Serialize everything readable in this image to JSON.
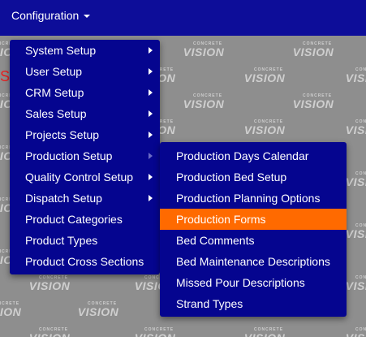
{
  "nav": {
    "menu_label": "Configuration",
    "left_fragment": "S"
  },
  "watermark": {
    "small": "CONCRETE",
    "large": "VISION",
    "tm": "TM"
  },
  "main_menu": {
    "items": [
      {
        "label": "System Setup",
        "has_submenu": true
      },
      {
        "label": "User Setup",
        "has_submenu": true
      },
      {
        "label": "CRM Setup",
        "has_submenu": true
      },
      {
        "label": "Sales Setup",
        "has_submenu": true
      },
      {
        "label": "Projects Setup",
        "has_submenu": true
      },
      {
        "label": "Production Setup",
        "has_submenu": true,
        "open": true
      },
      {
        "label": "Quality Control Setup",
        "has_submenu": true
      },
      {
        "label": "Dispatch Setup",
        "has_submenu": true
      },
      {
        "label": "Product Categories",
        "has_submenu": false
      },
      {
        "label": "Product Types",
        "has_submenu": false
      },
      {
        "label": "Product Cross Sections",
        "has_submenu": false
      }
    ]
  },
  "sub_menu": {
    "items": [
      {
        "label": "Production Days Calendar"
      },
      {
        "label": "Production Bed Setup"
      },
      {
        "label": "Production Planning Options"
      },
      {
        "label": "Production Forms",
        "highlighted": true
      },
      {
        "label": "Bed Comments"
      },
      {
        "label": "Bed Maintenance Descriptions"
      },
      {
        "label": "Missed Pour Descriptions"
      },
      {
        "label": "Strand Types"
      }
    ]
  },
  "colors": {
    "nav_bg": "#0d0d99",
    "menu_bg": "#05058f",
    "highlight": "#ff6a00",
    "page_bg": "#8e8e8e"
  }
}
